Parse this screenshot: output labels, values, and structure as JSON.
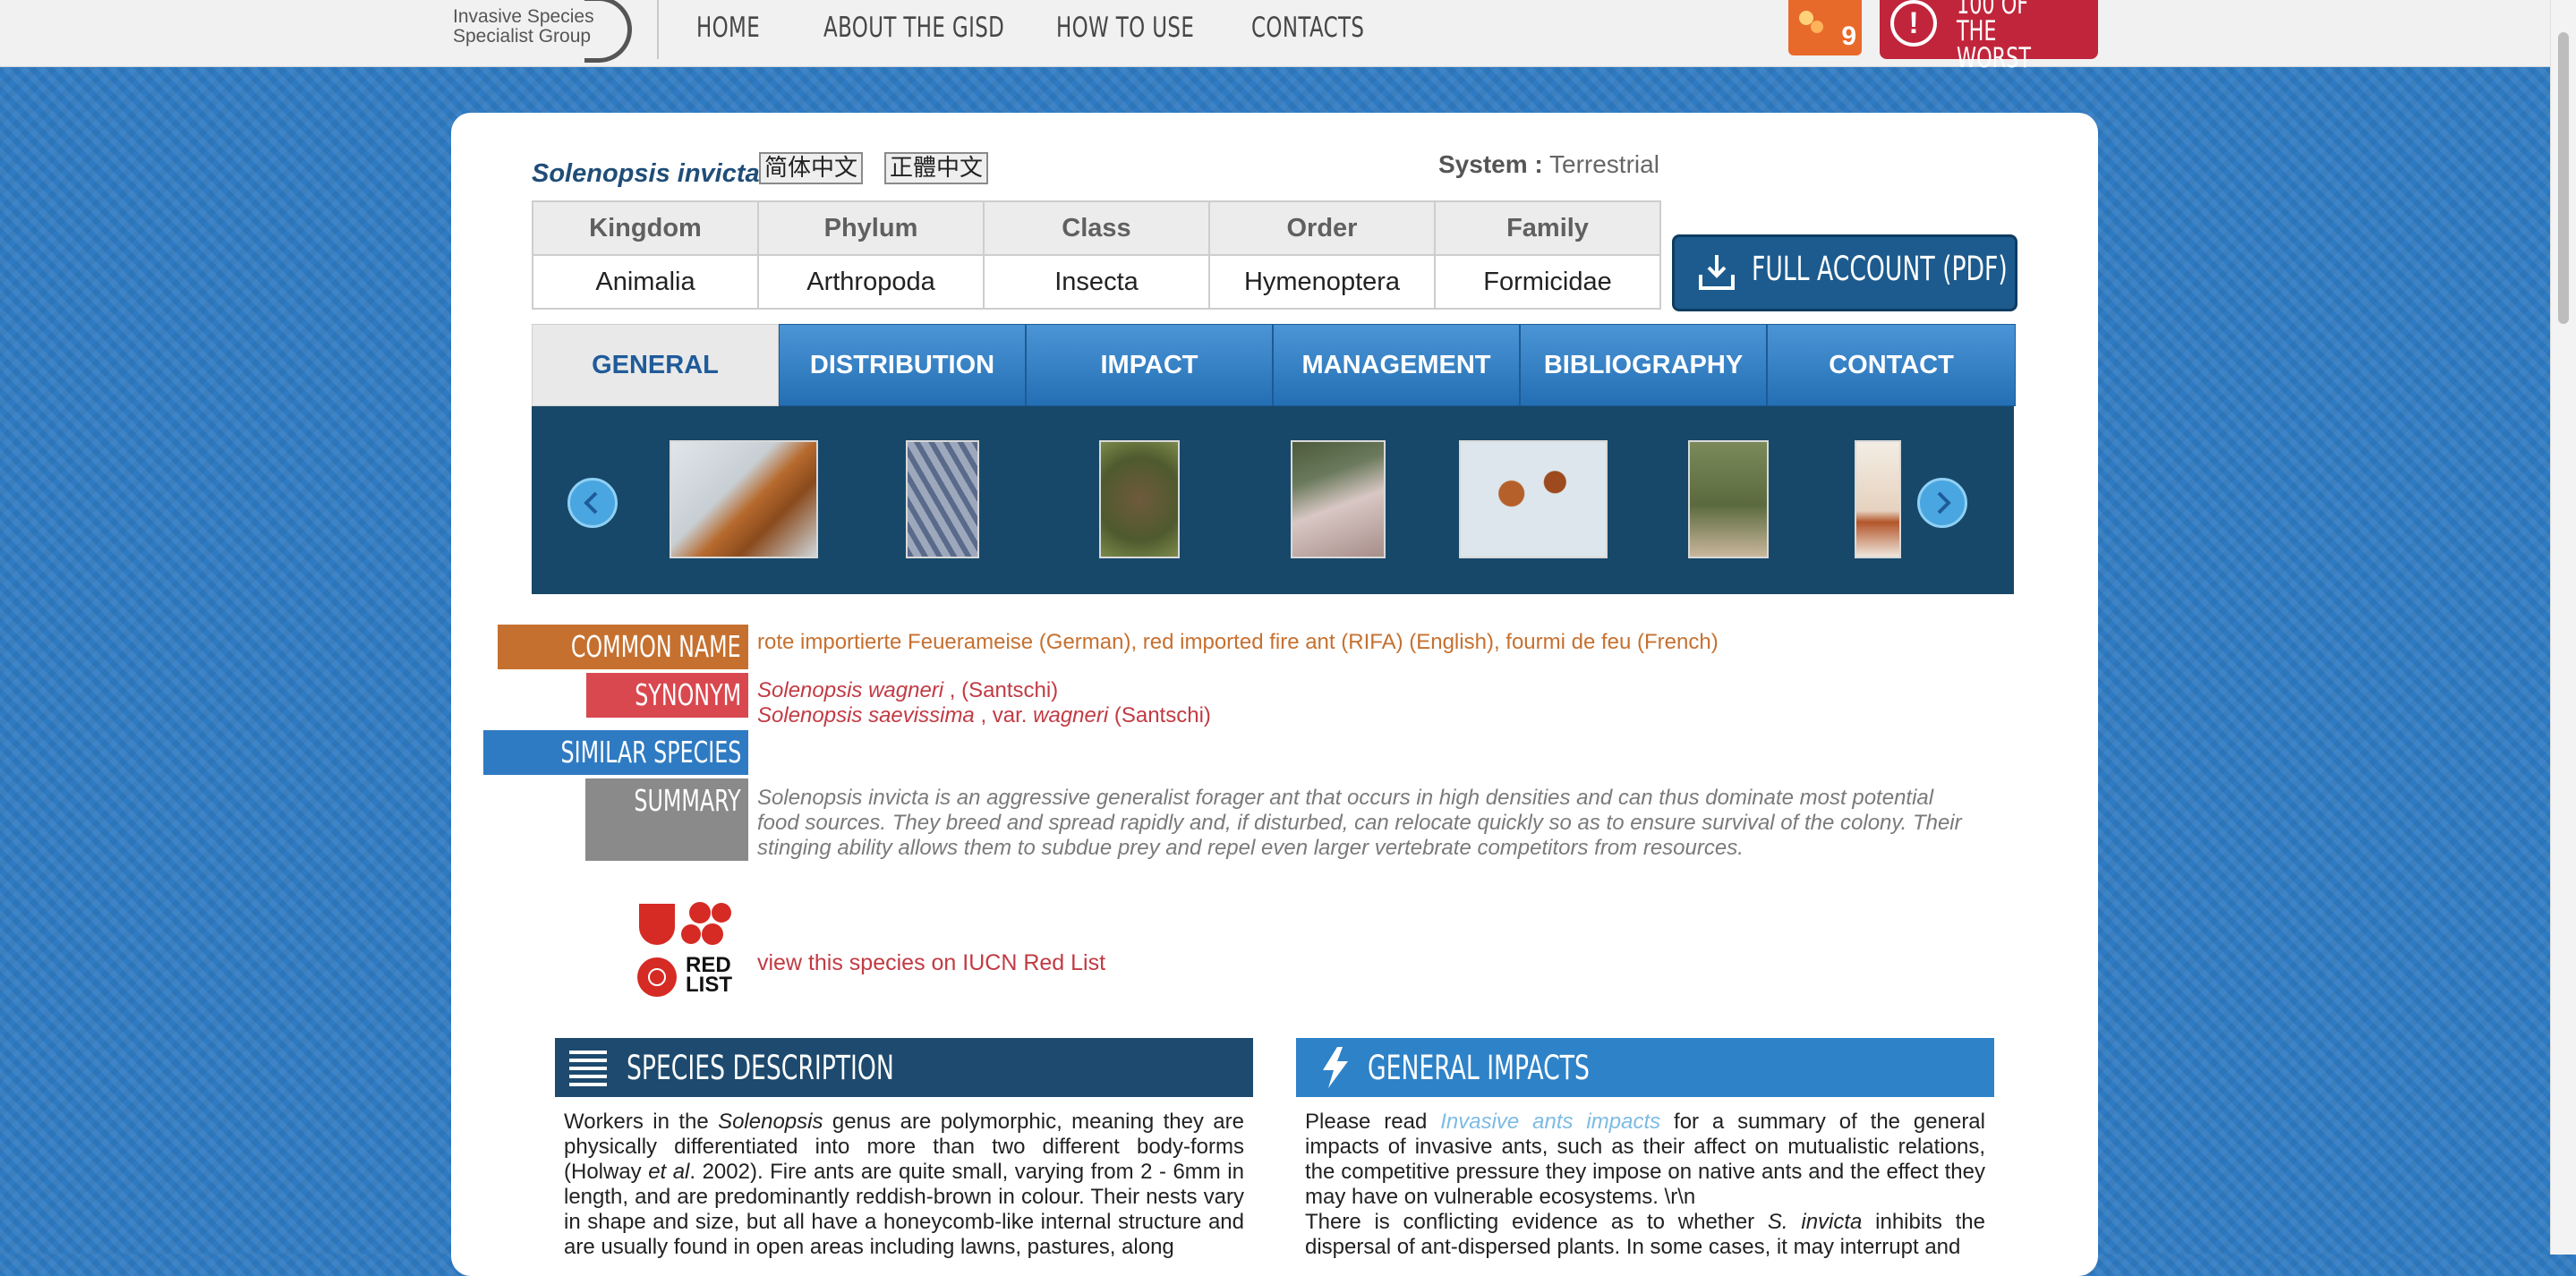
{
  "nav": {
    "logo_line1": "Invasive Species",
    "logo_line2": "Specialist Group",
    "links": [
      "HOME",
      "ABOUT THE GISD",
      "HOW TO USE",
      "CONTACTS"
    ],
    "badge_number": "9",
    "worst_line1": "100 OF",
    "worst_line2": "THE WORST"
  },
  "species": {
    "name": "Solenopsis invicta",
    "lang_simplified": "简体中文",
    "lang_traditional": "正體中文",
    "system_label": "System :",
    "system_value": "Terrestrial"
  },
  "taxonomy": {
    "headers": [
      "Kingdom",
      "Phylum",
      "Class",
      "Order",
      "Family"
    ],
    "values": [
      "Animalia",
      "Arthropoda",
      "Insecta",
      "Hymenoptera",
      "Formicidae"
    ]
  },
  "full_account_label": "FULL ACCOUNT (PDF)",
  "tabs": [
    "GENERAL",
    "DISTRIBUTION",
    "IMPACT",
    "MANAGEMENT",
    "BIBLIOGRAPHY",
    "CONTACT"
  ],
  "info": {
    "common_name_label": "COMMON NAME",
    "common_name_value": "rote importierte Feuerameise (German), red imported fire ant (RIFA) (English), fourmi de feu (French)",
    "synonym_label": "SYNONYM",
    "synonym1_name": "Solenopsis wagneri",
    "synonym1_rest": " , (Santschi)",
    "synonym2_name": "Solenopsis saevissima",
    "synonym2_mid": " , var. ",
    "synonym2_var": "wagneri",
    "synonym2_rest": " (Santschi)",
    "similar_label": "SIMILAR SPECIES",
    "summary_label": "SUMMARY",
    "summary_text": "Solenopsis invicta is an aggressive generalist forager ant that occurs in high densities and can thus dominate most potential food sources. They breed and spread rapidly and, if disturbed, can relocate quickly so as to ensure survival of the colony. Their stinging ability allows them to subdue prey and repel even larger vertebrate competitors from resources.",
    "redlist_logo_text1": "RED",
    "redlist_logo_text2": "LIST",
    "redlist_link": "view this species on IUCN Red List"
  },
  "species_description": {
    "title": "SPECIES DESCRIPTION",
    "p1_a": "Workers in the ",
    "p1_b": "Solenopsis",
    "p1_c": " genus are polymorphic, meaning they are physically differentiated into more than two different body-forms (Holway ",
    "p1_d": "et al",
    "p1_e": ". 2002). Fire ants are quite small, varying from 2 - 6mm in length, and are predominantly reddish-brown in colour. Their nests vary in shape and size, but all have a honeycomb-like internal structure and are usually found in open areas including lawns, pastures, along"
  },
  "general_impacts": {
    "title": "GENERAL IMPACTS",
    "p1_a": "Please read ",
    "p1_link": "Invasive ants impacts",
    "p1_b": " for a summary of the general impacts of invasive ants, such as their affect on mutualistic relations, the competitive pressure they impose on native ants and the effect they may have on vulnerable ecosystems. \\r\\n",
    "p2_a": "There is conflicting evidence as to whether ",
    "p2_b": "S. invicta",
    "p2_c": " inhibits the dispersal of ant-dispersed plants. In some cases, it may interrupt and"
  },
  "colors": {
    "nav_bg": "#f1f1f1",
    "page_bg": "#2f7bc3",
    "common_name": "#c6702f",
    "synonym": "#c23a43",
    "similar": "#2f7bc3",
    "summary": "#8a8a8a",
    "dark_panel": "#1d4a6e",
    "light_panel": "#2e82c8",
    "worst_red": "#c1253b"
  }
}
